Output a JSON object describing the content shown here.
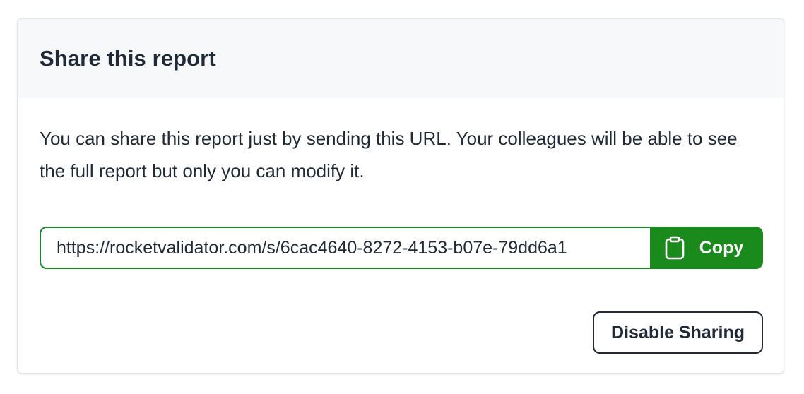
{
  "share_card": {
    "title": "Share this report",
    "description": "You can share this report just by sending this URL. Your colleagues will be able to see the full report but only you can modify it.",
    "url_value": "https://rocketvalidator.com/s/6cac4640-8272-4153-b07e-79dd6a1",
    "copy_label": "Copy",
    "copy_icon": "clipboard-icon",
    "disable_label": "Disable Sharing"
  },
  "colors": {
    "accent_green": "#1a8a1d",
    "text": "#1f2937",
    "header_bg": "#f7f8fa"
  }
}
